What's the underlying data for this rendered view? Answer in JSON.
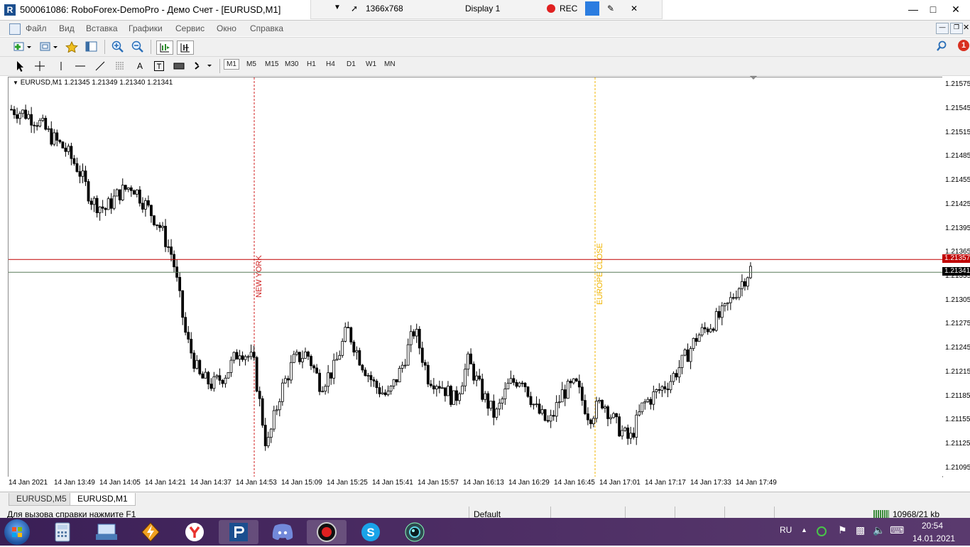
{
  "window": {
    "title": "500061086: RoboForex-DemoPro - Демо Счет - [EURUSD,M1]",
    "logo": "R"
  },
  "recorder": {
    "resolution": "1366x768",
    "display": "Display 1",
    "rec_label": "REC",
    "rec_color": "#e02020"
  },
  "menu": {
    "items": [
      "Файл",
      "Вид",
      "Вставка",
      "Графики",
      "Сервис",
      "Окно",
      "Справка"
    ]
  },
  "timeframes": [
    "M1",
    "M5",
    "M15",
    "M30",
    "H1",
    "H4",
    "D1",
    "W1",
    "MN"
  ],
  "notification_count": "1",
  "chart": {
    "info": "EURUSD,M1  1.21345 1.21349 1.21340 1.21341",
    "colors": {
      "bull": "#ffffff",
      "bear": "#000000",
      "wick": "#000000",
      "bid_line": "#c00000",
      "ask_line": "#5a7a5a",
      "new_york": "#d02020",
      "europe_close": "#f0b400"
    },
    "price_labels": [
      "1.21575",
      "1.21545",
      "1.21515",
      "1.21485",
      "1.21455",
      "1.21425",
      "1.21395",
      "1.21365",
      "1.21335",
      "1.21305",
      "1.21275",
      "1.21245",
      "1.21215",
      "1.21185",
      "1.21155",
      "1.21125",
      "1.21095"
    ],
    "bid_price": "1.21357",
    "last_price": "1.21341",
    "time_labels": [
      "14 Jan 2021",
      "14 Jan 13:49",
      "14 Jan 14:05",
      "14 Jan 14:21",
      "14 Jan 14:37",
      "14 Jan 14:53",
      "14 Jan 15:09",
      "14 Jan 15:25",
      "14 Jan 15:41",
      "14 Jan 15:57",
      "14 Jan 16:13",
      "14 Jan 16:29",
      "14 Jan 16:45",
      "14 Jan 17:01",
      "14 Jan 17:17",
      "14 Jan 17:33",
      "14 Jan 17:49"
    ],
    "session_lines": [
      {
        "label": "NEW YORK",
        "time": "14 Jan 14:53"
      },
      {
        "label": "EUROPE CLOSE",
        "time": "14 Jan 16:45"
      }
    ]
  },
  "chart_data": {
    "type": "candlestick",
    "symbol": "EURUSD",
    "timeframe": "M1",
    "ylim": [
      1.21085,
      1.21585
    ],
    "trend_points": [
      1.21545,
      1.2154,
      1.2153,
      1.2151,
      1.21495,
      1.2147,
      1.2143,
      1.2142,
      1.2144,
      1.2145,
      1.21425,
      1.214,
      1.2136,
      1.2126,
      1.2121,
      1.212,
      1.21215,
      1.21245,
      1.2123,
      1.2112,
      1.2119,
      1.2123,
      1.2124,
      1.212,
      1.2122,
      1.2127,
      1.2123,
      1.212,
      1.21185,
      1.2122,
      1.2127,
      1.2121,
      1.212,
      1.2118,
      1.2123,
      1.2119,
      1.2116,
      1.212,
      1.2121,
      1.2117,
      1.2115,
      1.2119,
      1.212,
      1.2116,
      1.2118,
      1.2115,
      1.2113,
      1.21175,
      1.2119,
      1.21205,
      1.2123,
      1.2126,
      1.21275,
      1.2129,
      1.2132,
      1.21345
    ]
  },
  "tabs": [
    "EURUSD,M5",
    "EURUSD,M1"
  ],
  "status": {
    "help": "Для вызова справки нажмите F1",
    "profile": "Default",
    "traffic": "10968/21 kb"
  },
  "taskbar": {
    "lang": "RU",
    "time": "20:54",
    "date": "14.01.2021"
  }
}
